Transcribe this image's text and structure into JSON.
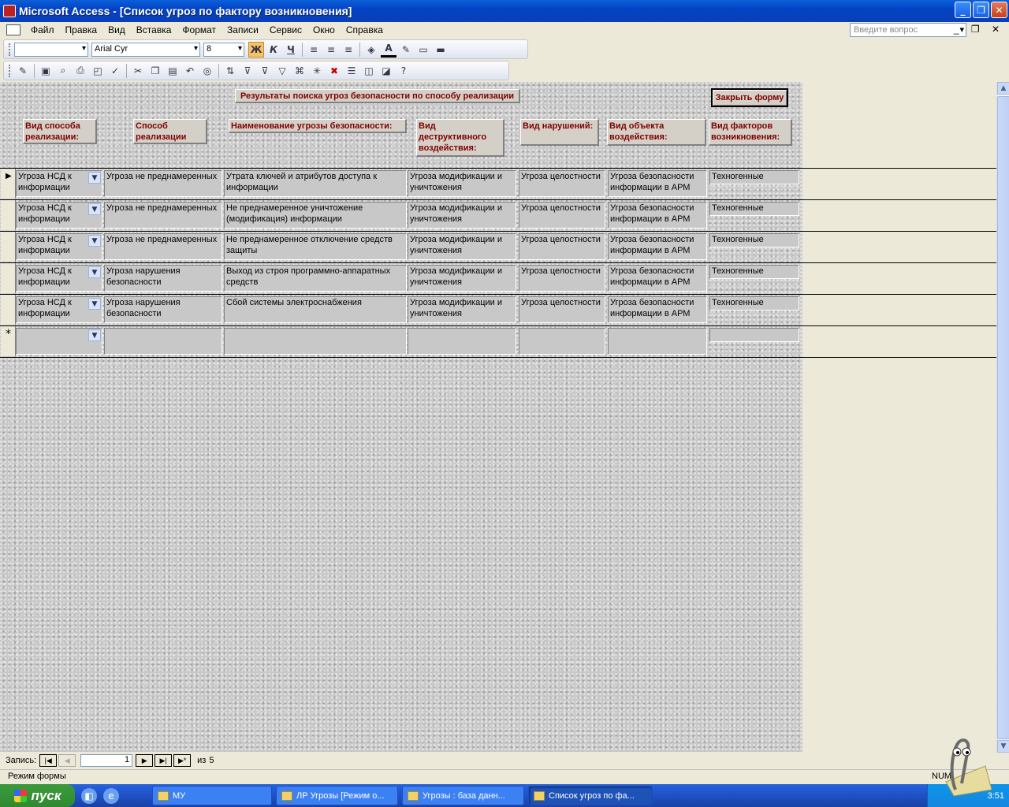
{
  "window": {
    "title": "Microsoft Access - [Список угроз по фактору возникновения]"
  },
  "menu": {
    "items": [
      "Файл",
      "Правка",
      "Вид",
      "Вставка",
      "Формат",
      "Записи",
      "Сервис",
      "Окно",
      "Справка"
    ],
    "help_placeholder": "Введите вопрос"
  },
  "toolbar": {
    "font_name": "Arial Cyr",
    "font_size": "8",
    "bold": "Ж",
    "italic": "К",
    "underline": "Ч"
  },
  "form": {
    "title": "Результаты поиска угроз безопасности по способу реализации",
    "close_button": "Закрыть форму",
    "columns": [
      "Вид способа реализации:",
      "Способ реализации",
      "Наименование угрозы безопасности:",
      "Вид деструктивного воздействия:",
      "Вид нарушений:",
      "Вид объекта воздействия:",
      "Вид факторов возникновения:"
    ],
    "rows": [
      [
        "Угроза НСД к информации",
        "Угроза не преднамеренных",
        "Утрата ключей и атрибутов доступа к информации",
        "Угроза модификации и уничтожения",
        "Угроза целостности",
        "Угроза безопасности информации в АРМ",
        "Техногенные"
      ],
      [
        "Угроза НСД к информации",
        "Угроза не преднамеренных",
        "Не преднамеренное уничтожение (модификация) информации",
        "Угроза модификации и уничтожения",
        "Угроза целостности",
        "Угроза безопасности информации в АРМ",
        "Техногенные"
      ],
      [
        "Угроза НСД к информации",
        "Угроза не преднамеренных",
        "Не преднамеренное отключение средств защиты",
        "Угроза модификации и уничтожения",
        "Угроза целостности",
        "Угроза безопасности информации в АРМ",
        "Техногенные"
      ],
      [
        "Угроза НСД к информации",
        "Угроза нарушения безопасности",
        "Выход из строя программно-аппаратных средств",
        "Угроза модификации и уничтожения",
        "Угроза целостности",
        "Угроза безопасности информации в АРМ",
        "Техногенные"
      ],
      [
        "Угроза НСД к информации",
        "Угроза нарушения безопасности",
        "Сбой системы электроснабжения",
        "Угроза модификации и уничтожения",
        "Угроза целостности",
        "Угроза безопасности информации в АРМ",
        "Техногенные"
      ]
    ],
    "new_record_marker": "*",
    "current_record_marker": "▶"
  },
  "navigation": {
    "label": "Запись:",
    "current": "1",
    "of_label": "из",
    "total": "5"
  },
  "status": {
    "mode": "Режим формы",
    "num": "NUM"
  },
  "taskbar": {
    "start": "пуск",
    "tasks": [
      "МУ",
      "ЛР Угрозы [Режим о...",
      "Угрозы : база данн...",
      "Список угроз по фа..."
    ],
    "clock": "3:51"
  }
}
